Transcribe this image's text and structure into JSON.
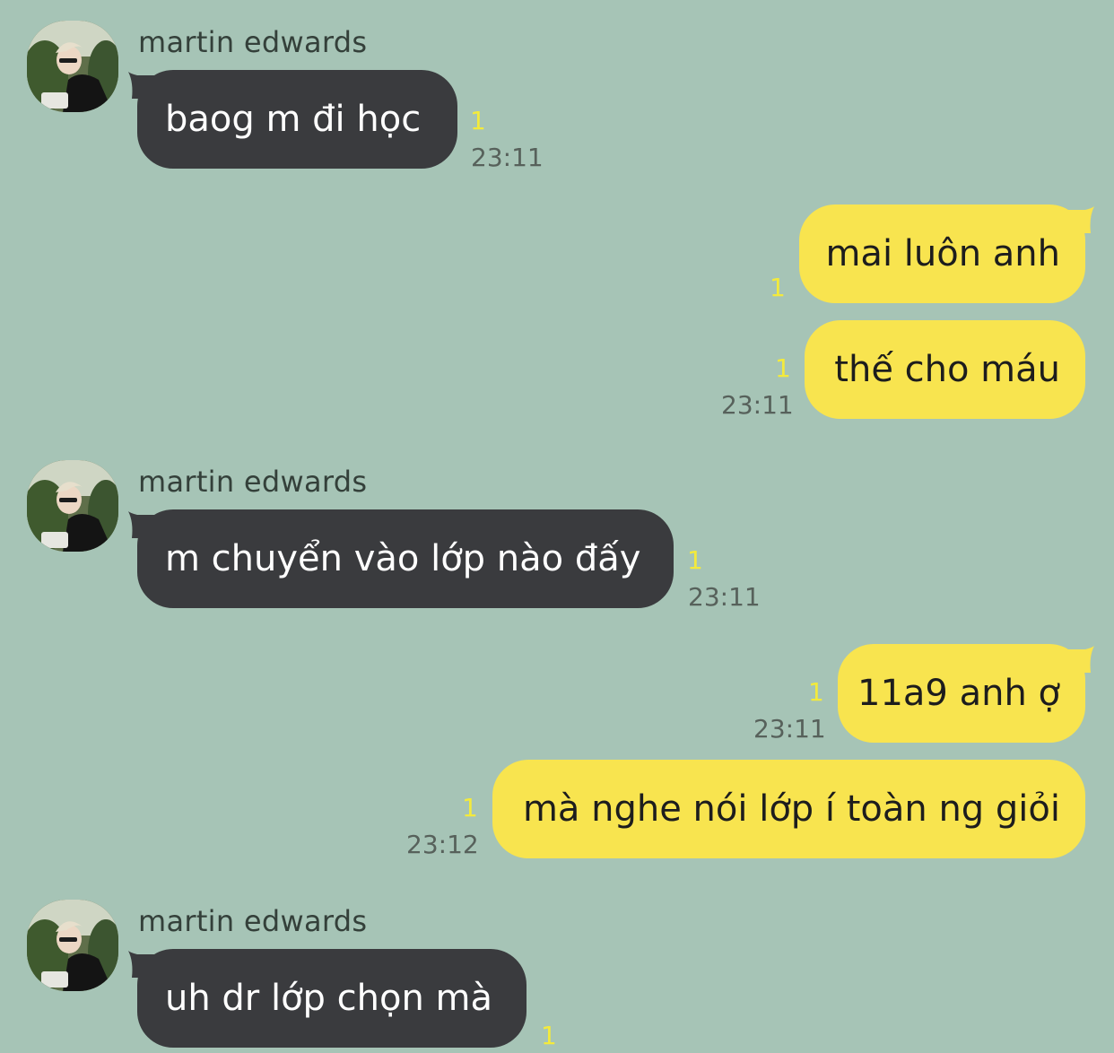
{
  "contact": {
    "name": "martin edwards",
    "avatar": "contact-photo"
  },
  "messages": [
    {
      "sender": "martin edwards",
      "text": "baog m đi học",
      "unread": "1",
      "time": "23:11"
    },
    {
      "text": "mai luôn anh",
      "unread": "1"
    },
    {
      "text": "thế cho máu",
      "unread": "1",
      "time": "23:11"
    },
    {
      "sender": "martin edwards",
      "text": "m chuyển vào lớp nào đấy",
      "unread": "1",
      "time": "23:11"
    },
    {
      "text": "11a9 anh ợ",
      "unread": "1",
      "time": "23:11"
    },
    {
      "text": "mà nghe nói lớp í toàn ng giỏi",
      "unread": "1",
      "time": "23:12"
    },
    {
      "sender": "martin edwards",
      "text": "uh dr lớp chọn mà",
      "unread": "1"
    }
  ],
  "colors": {
    "background": "#a6c4b6",
    "incoming_bubble": "#3a3b3e",
    "outgoing_bubble": "#f8e44f",
    "unread_count": "#f3ea3c"
  }
}
